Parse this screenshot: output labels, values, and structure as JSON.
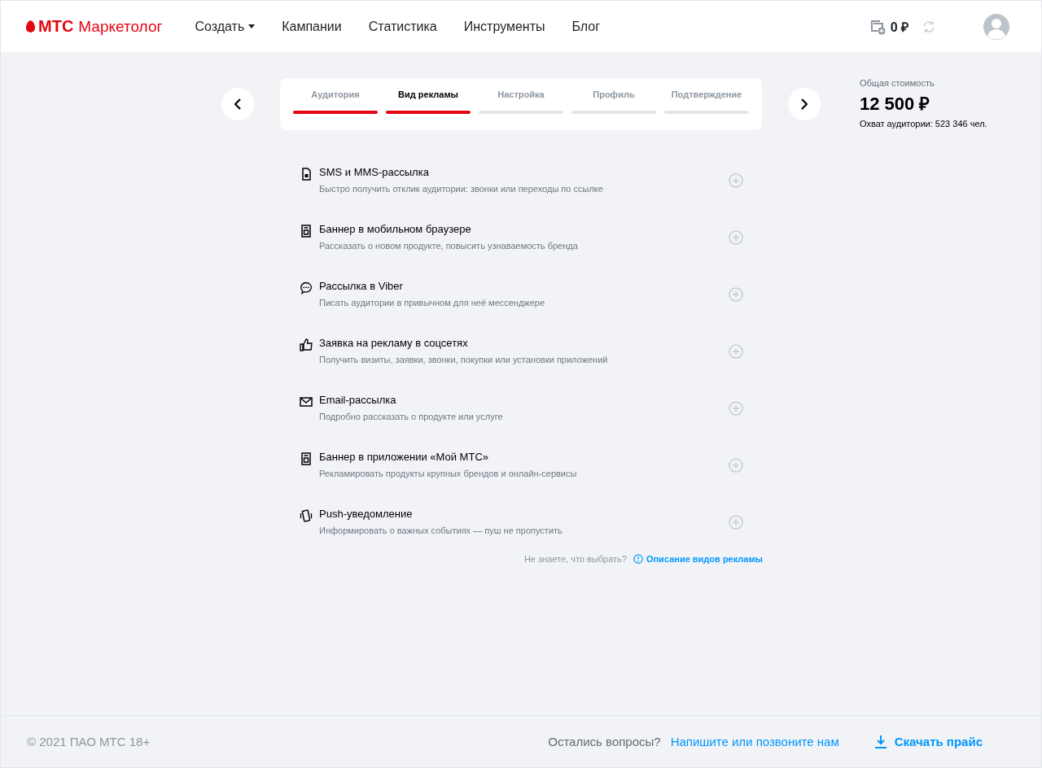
{
  "header": {
    "brand": "МТС",
    "product": "Маркетолог",
    "nav": [
      {
        "label": "Создать",
        "dropdown": true
      },
      {
        "label": "Кампании",
        "dropdown": false
      },
      {
        "label": "Статистика",
        "dropdown": false
      },
      {
        "label": "Инструменты",
        "dropdown": false
      },
      {
        "label": "Блог",
        "dropdown": false
      }
    ],
    "balance": "0 ₽"
  },
  "steps": [
    {
      "label": "Аудитория",
      "selected": false,
      "completed": true
    },
    {
      "label": "Вид рекламы",
      "selected": true,
      "completed": false
    },
    {
      "label": "Настройка",
      "selected": false,
      "completed": false
    },
    {
      "label": "Профиль",
      "selected": false,
      "completed": false
    },
    {
      "label": "Подтверждение",
      "selected": false,
      "completed": false
    }
  ],
  "summary": {
    "label": "Общая стоимость",
    "total": "12 500 ₽",
    "reach": "Охват аудитории: 523 346 чел."
  },
  "ad_types": [
    {
      "kind": "sms",
      "title": "SMS и MMS-рассылка",
      "description": "Быстро получить отклик аудитории: звонки или переходы по ссылке"
    },
    {
      "kind": "banner",
      "title": "Баннер в мобильном браузере",
      "description": "Рассказать о новом продукте, повысить узнаваемость бренда"
    },
    {
      "kind": "chat",
      "title": "Рассылка в Viber",
      "description": "Писать аудитории в привычном для неё мессенджере"
    },
    {
      "kind": "like",
      "title": "Заявка на рекламу в соцсетях",
      "description": "Получить визиты, заявки, звонки, покупки или установки приложений"
    },
    {
      "kind": "email",
      "title": "Email-рассылка",
      "description": "Подробно рассказать о продукте или услуге"
    },
    {
      "kind": "banner",
      "title": "Баннер в приложении «Мой МТС»",
      "description": "Рекламировать продукты крупных брендов и онлайн-сервисы"
    },
    {
      "kind": "push",
      "title": "Push-уведомление",
      "description": "Информировать о важных событиях — пуш не пропустить"
    }
  ],
  "help": {
    "question": "Не знаете, что выбрать?",
    "link": "Описание видов рекламы"
  },
  "footer": {
    "copyright": "© 2021 ПАО МТС 18+",
    "question": "Остались вопросы?",
    "contact": "Напишите или позвоните нам",
    "download": "Скачать прайс"
  }
}
